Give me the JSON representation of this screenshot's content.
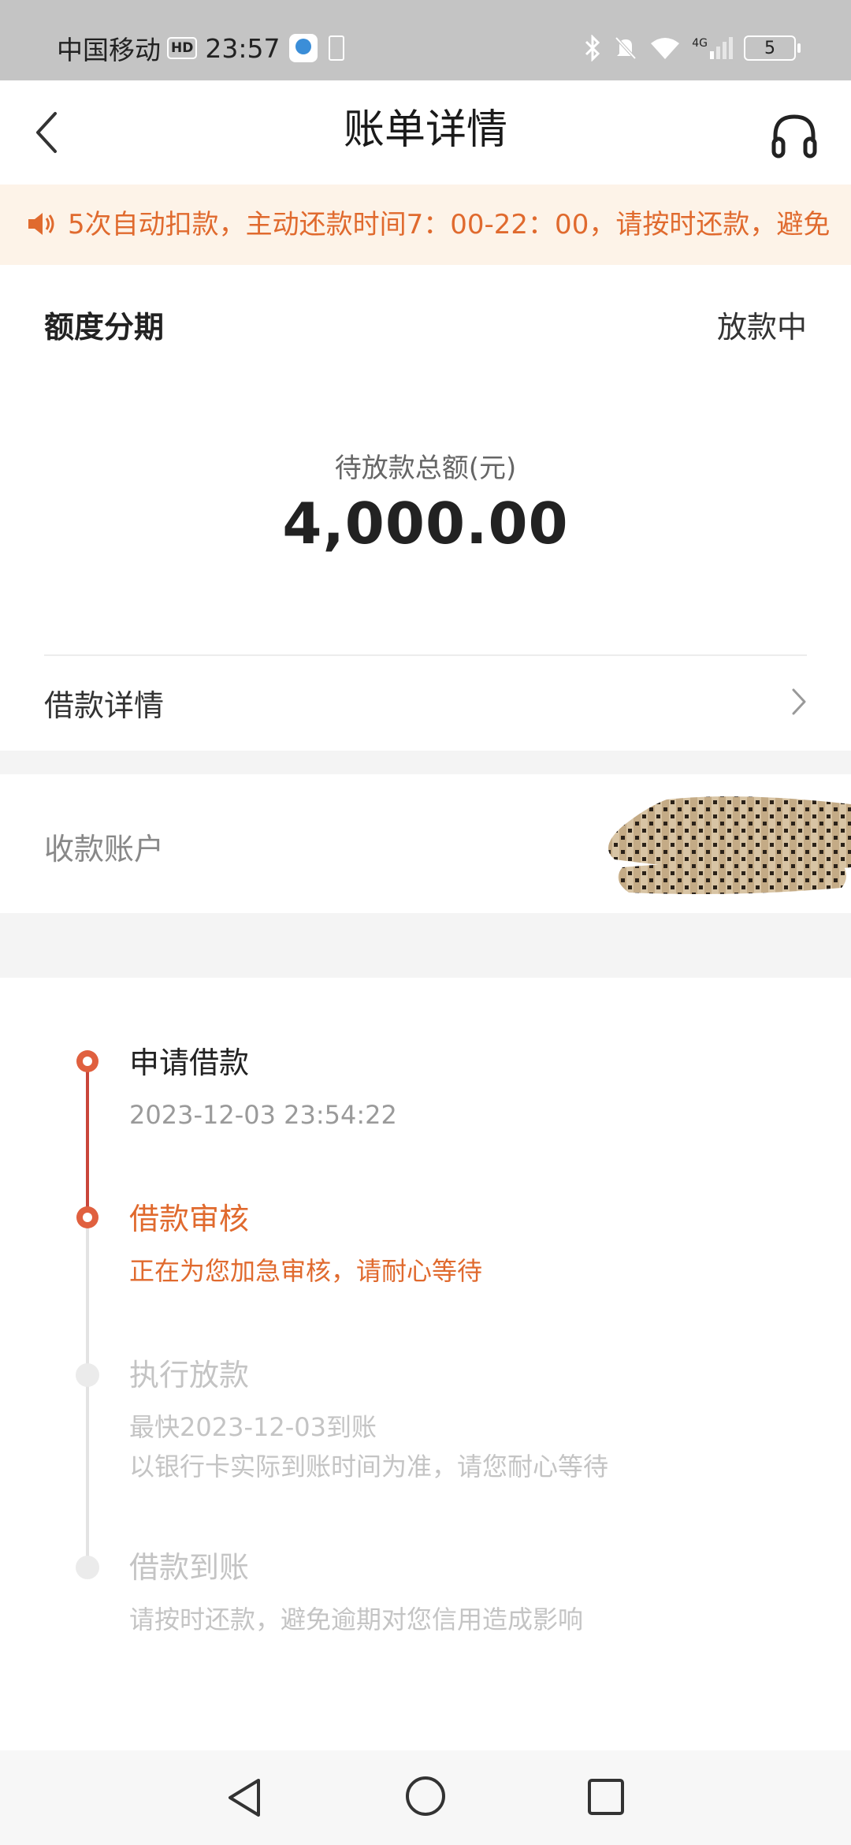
{
  "status_bar": {
    "carrier": "中国移动",
    "hd": "HD",
    "time": "23:57",
    "network": "4G",
    "battery": "5"
  },
  "header": {
    "title": "账单详情"
  },
  "notice": {
    "text": "5次自动扣款，主动还款时间7：00-22：00，请按时还款，避免"
  },
  "summary": {
    "product": "额度分期",
    "status": "放款中",
    "amount_label": "待放款总额(元)",
    "amount": "4,000.00",
    "loan_detail_label": "借款详情"
  },
  "account": {
    "label": "收款账户"
  },
  "timeline": {
    "steps": [
      {
        "title": "申请借款",
        "subtitle": "2023-12-03 23:54:22",
        "state": "done"
      },
      {
        "title": "借款审核",
        "subtitle": "正在为您加急审核，请耐心等待",
        "state": "current"
      },
      {
        "title": "执行放款",
        "subtitle": "最快2023-12-03到账",
        "subtitle2": "以银行卡实际到账时间为准，请您耐心等待",
        "state": "pending"
      },
      {
        "title": "借款到账",
        "subtitle": "请按时还款，避免逾期对您信用造成影响",
        "state": "pending"
      }
    ]
  },
  "colors": {
    "accent": "#e06a2e",
    "timeline_red": "#c9453a",
    "notice_bg": "#fdf3e8",
    "muted": "#bdbdbd"
  }
}
